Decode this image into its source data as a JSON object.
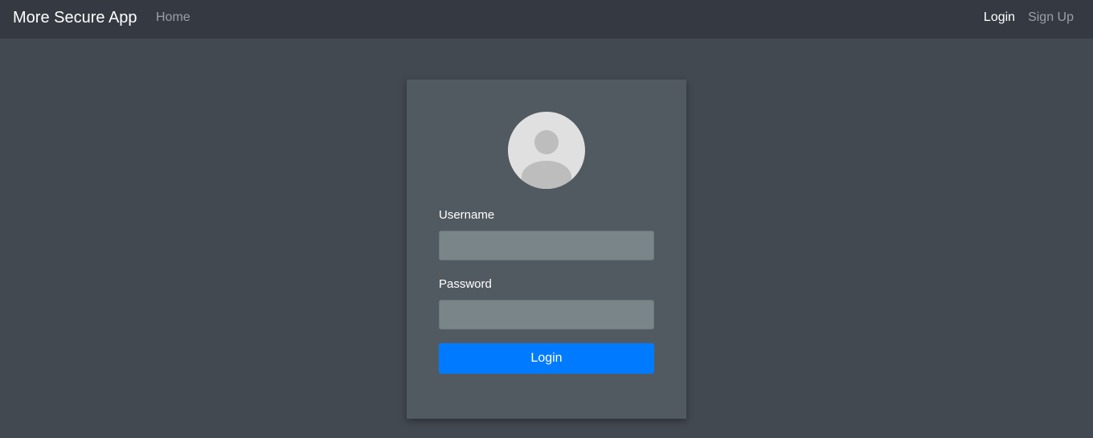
{
  "navbar": {
    "brand": "More Secure App",
    "home_label": "Home",
    "login_label": "Login",
    "signup_label": "Sign Up"
  },
  "login_form": {
    "avatar_icon": "user-avatar-icon",
    "username_label": "Username",
    "username_value": "",
    "password_label": "Password",
    "password_value": "",
    "submit_label": "Login"
  },
  "colors": {
    "page_background": "#424951",
    "navbar_background": "#353a42",
    "card_background": "#525a61",
    "input_background": "#7a8589",
    "primary_button": "#007bff"
  }
}
